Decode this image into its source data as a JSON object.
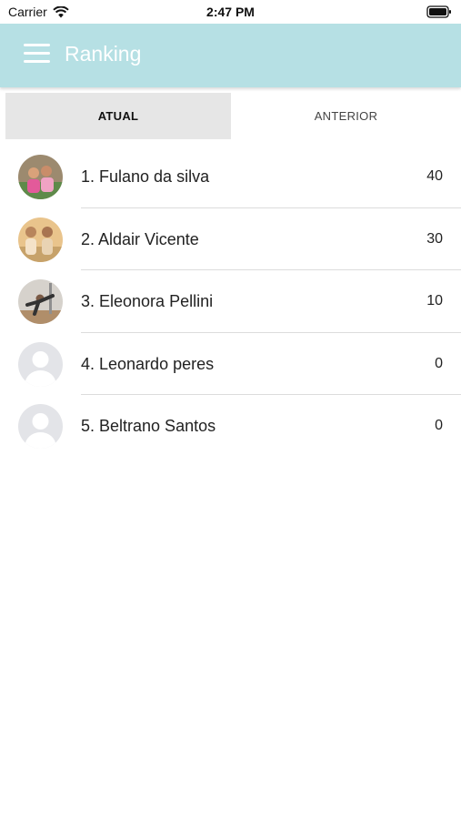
{
  "status_bar": {
    "carrier": "Carrier",
    "time": "2:47 PM"
  },
  "header": {
    "title": "Ranking"
  },
  "tabs": [
    {
      "label": "ATUAL",
      "active": true
    },
    {
      "label": "ANTERIOR",
      "active": false
    }
  ],
  "ranking": [
    {
      "name": "1. Fulano da silva",
      "score": "40",
      "avatar": "photo-avatar"
    },
    {
      "name": "2. Aldair Vicente",
      "score": "30",
      "avatar": "photo-avatar"
    },
    {
      "name": "3. Eleonora Pellini",
      "score": "10",
      "avatar": "photo-avatar"
    },
    {
      "name": "4. Leonardo peres",
      "score": "0",
      "avatar": "default-avatar"
    },
    {
      "name": "5. Beltrano Santos",
      "score": "0",
      "avatar": "default-avatar"
    }
  ],
  "colors": {
    "header_bg": "#b6e0e4",
    "active_tab_bg": "#e6e6e6",
    "divider": "#dcdcdc"
  }
}
